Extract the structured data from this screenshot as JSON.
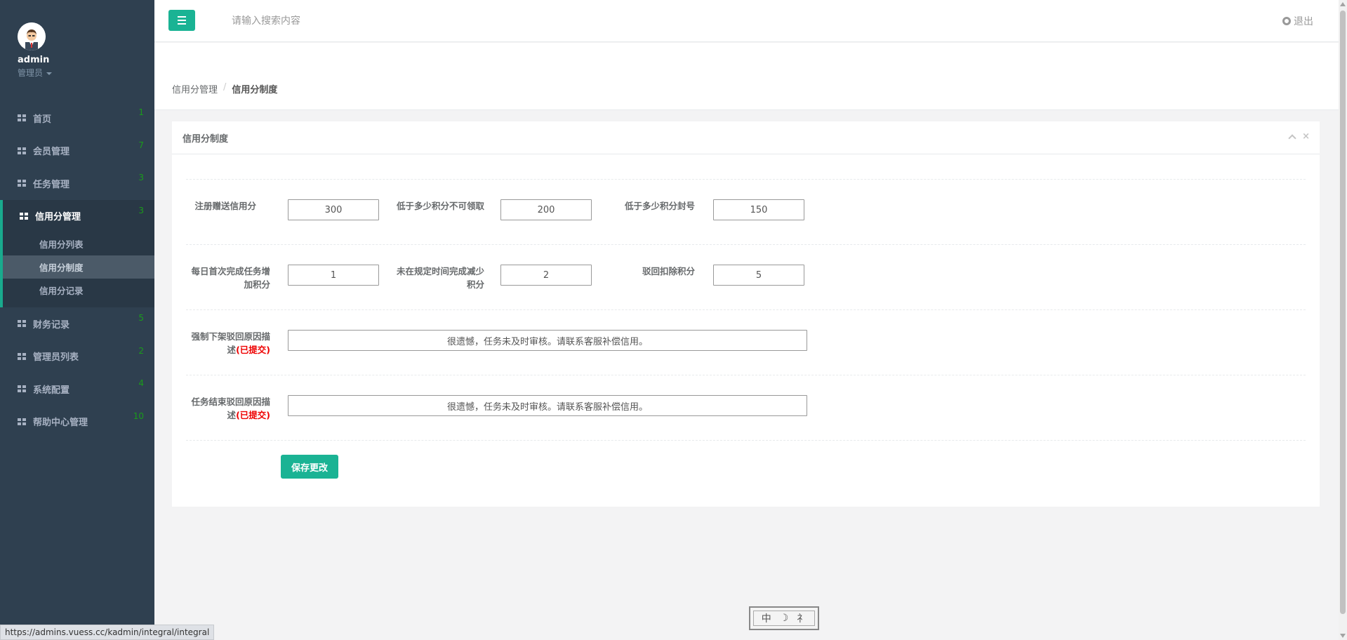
{
  "user": {
    "name": "admin",
    "role": "管理员"
  },
  "nav": {
    "items": [
      {
        "label": "首页",
        "badge": "1"
      },
      {
        "label": "会员管理",
        "badge": "7"
      },
      {
        "label": "任务管理",
        "badge": "3"
      },
      {
        "label": "信用分管理",
        "badge": "3"
      },
      {
        "label": "财务记录",
        "badge": "5"
      },
      {
        "label": "管理员列表",
        "badge": "2"
      },
      {
        "label": "系统配置",
        "badge": "4"
      },
      {
        "label": "帮助中心管理",
        "badge": "10"
      }
    ],
    "sub_items": [
      "信用分列表",
      "信用分制度",
      "信用分记录"
    ]
  },
  "topbar": {
    "search_placeholder": "请输入搜索内容",
    "logout_label": "退出"
  },
  "breadcrumb": {
    "parent": "信用分管理",
    "sep": "/",
    "current": "信用分制度"
  },
  "panel": {
    "title": "信用分制度",
    "close_symbol": "×"
  },
  "form": {
    "register_credit": {
      "label": "注册赠送信用分",
      "value": "300"
    },
    "below_no_claim": {
      "label": "低于多少积分不可领取",
      "value": "200"
    },
    "below_ban": {
      "label": "低于多少积分封号",
      "value": "150"
    },
    "daily_first_bonus": {
      "label": "每日首次完成任务增加积分",
      "value": "1"
    },
    "late_penalty": {
      "label": "未在规定时间完成减少积分",
      "value": "2"
    },
    "reject_deduct": {
      "label": "驳回扣除积分",
      "value": "5"
    },
    "force_delist_reason": {
      "label": "强制下架驳回原因描述",
      "tag": "(已提交)",
      "value": "很遗憾，任务未及时审核。请联系客服补偿信用。"
    },
    "task_end_reason": {
      "label": "任务结束驳回原因描述",
      "tag": "(已提交)",
      "value": "很遗憾，任务未及时审核。请联系客服补偿信用。"
    },
    "save_label": "保存更改"
  },
  "status_url": "https://admins.vuess.cc/kadmin/integral/integral",
  "ime": {
    "lang": "中",
    "moon": "☽",
    "punct": "⺭"
  },
  "colors": {
    "sidebar": "#2f4050",
    "accent": "#1ab394",
    "badge": "#1a9c1a",
    "warn": "#ee0000"
  }
}
